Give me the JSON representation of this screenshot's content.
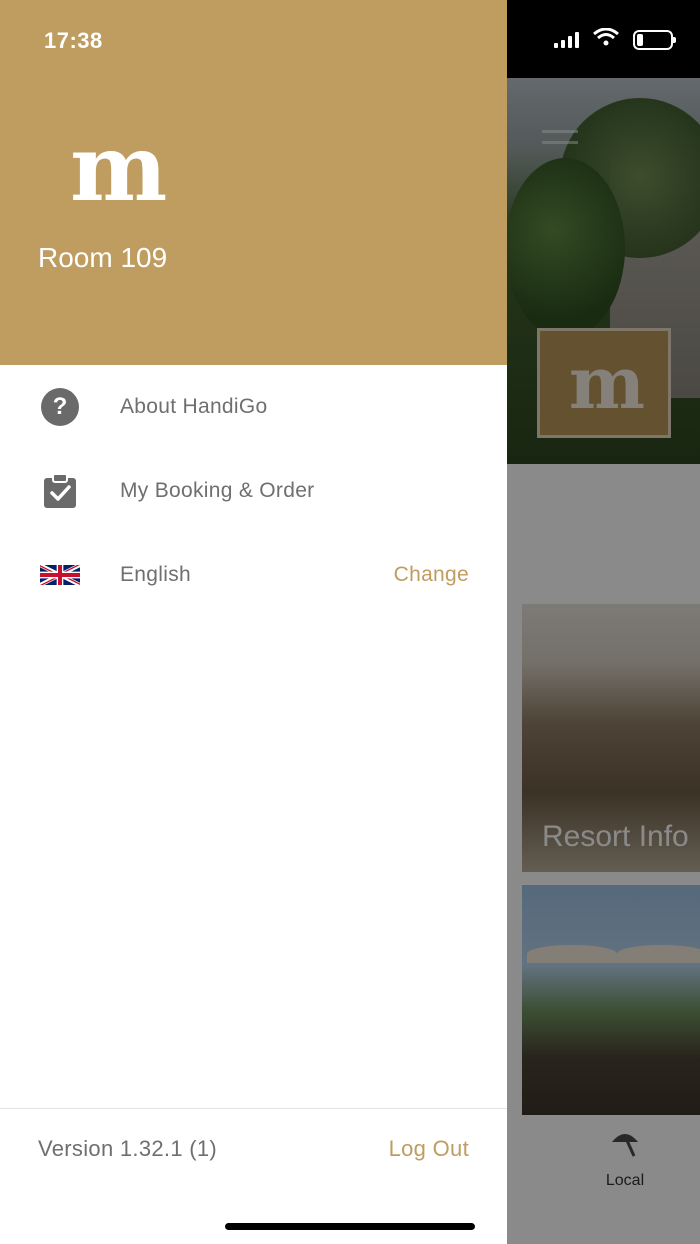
{
  "status_bar": {
    "time": "17:38"
  },
  "drawer": {
    "brand_logo": "m",
    "room": "Room 109",
    "menu": [
      {
        "label": "About HandiGo",
        "icon": "help-circle-icon"
      },
      {
        "label": "My Booking & Order",
        "icon": "clipboard-check-icon"
      },
      {
        "label": "English",
        "icon": "uk-flag-icon",
        "action": "Change"
      }
    ],
    "version": "Version 1.32.1 (1)",
    "logout": "Log Out"
  },
  "background_app": {
    "logo": "m",
    "cards": [
      {
        "label": "Resort Info"
      },
      {
        "label": ""
      }
    ],
    "tab": {
      "label": "Local",
      "icon": "beach-umbrella-icon"
    }
  },
  "colors": {
    "accent": "#bf9c5f",
    "text_muted": "#6f6f6f",
    "header_bg": "#bf9c5f"
  }
}
